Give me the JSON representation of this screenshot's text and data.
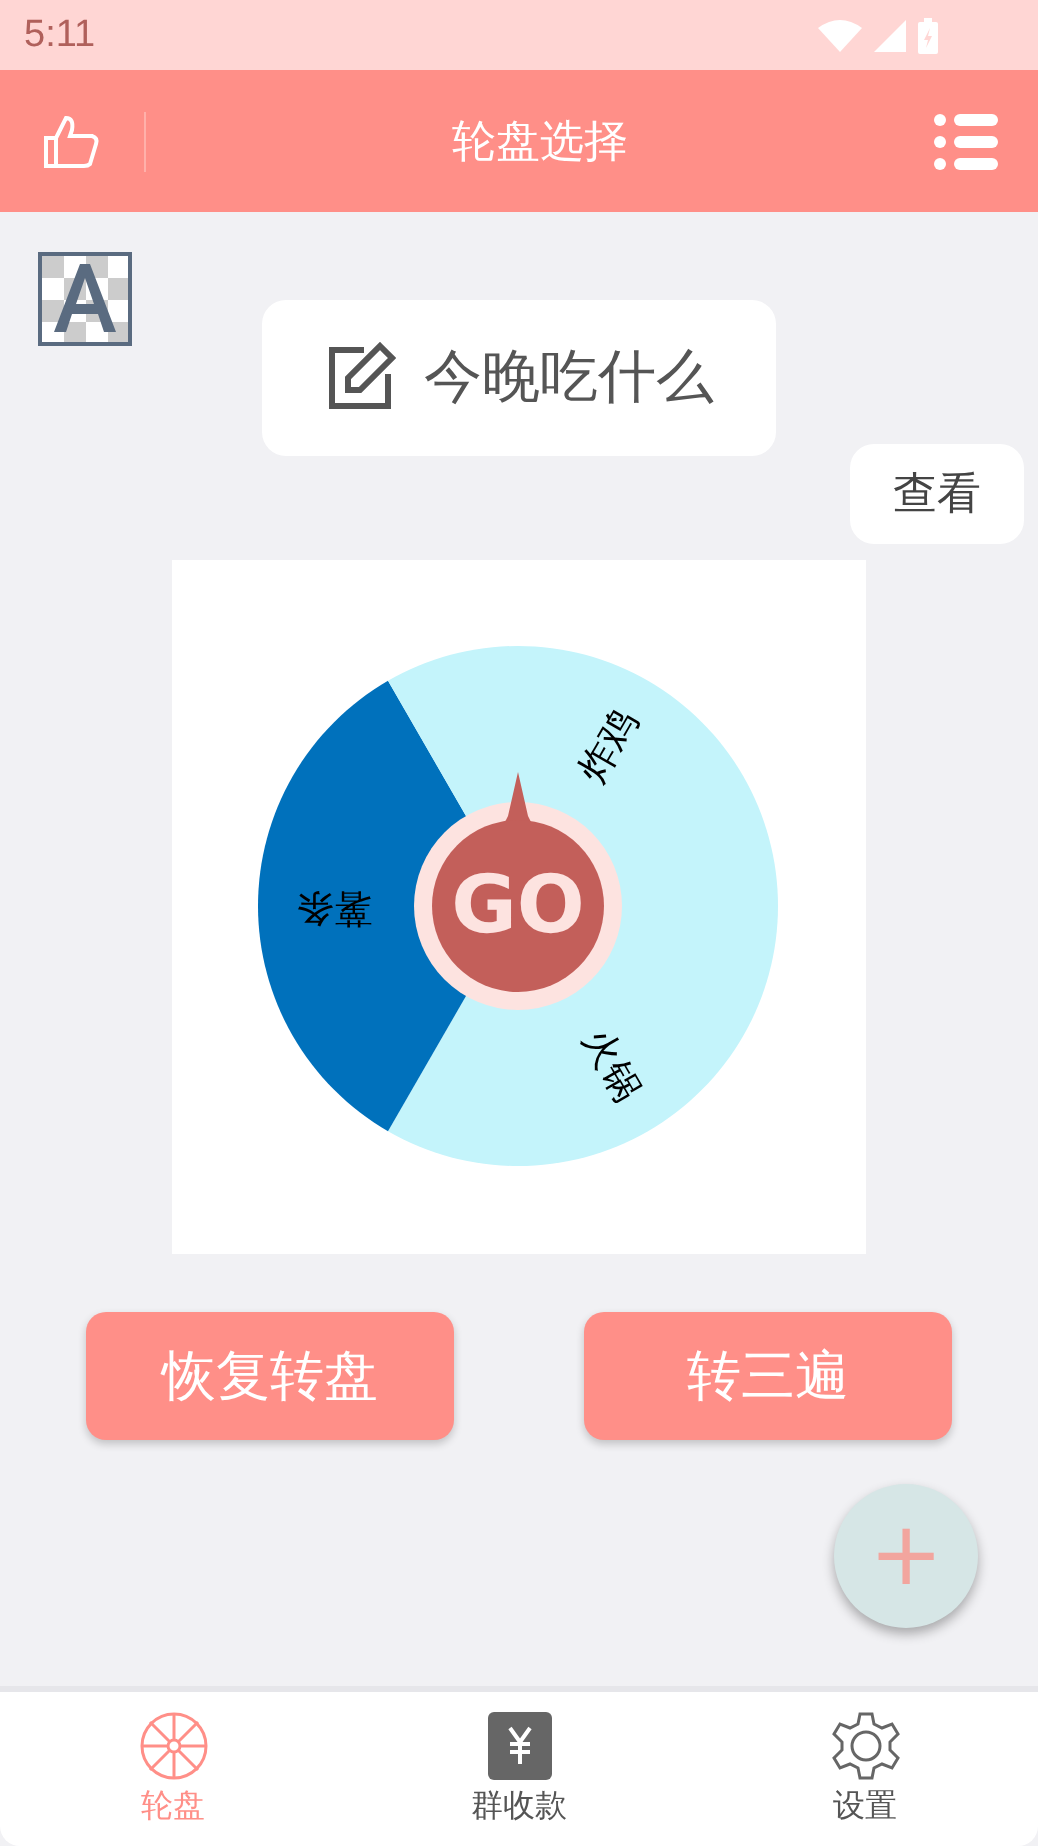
{
  "status_bar": {
    "time": "5:11"
  },
  "app_bar": {
    "title": "轮盘选择"
  },
  "question": {
    "text": "今晚吃什么"
  },
  "view_button": "查看",
  "wheel": {
    "go": "GO",
    "segments": [
      {
        "label": "火锅",
        "color": "#c4f4fb"
      },
      {
        "label": "薯条",
        "color": "#0071bc"
      },
      {
        "label": "炸鸡",
        "color": "#c4f4fb"
      }
    ]
  },
  "buttons": [
    "恢复转盘",
    "转三遍"
  ],
  "fab": "+",
  "bottom_nav": [
    {
      "label": "轮盘",
      "selected": true,
      "kind": "wheel"
    },
    {
      "label": "群收款",
      "selected": false,
      "kind": "money"
    },
    {
      "label": "设置",
      "selected": false,
      "kind": "settings"
    }
  ]
}
